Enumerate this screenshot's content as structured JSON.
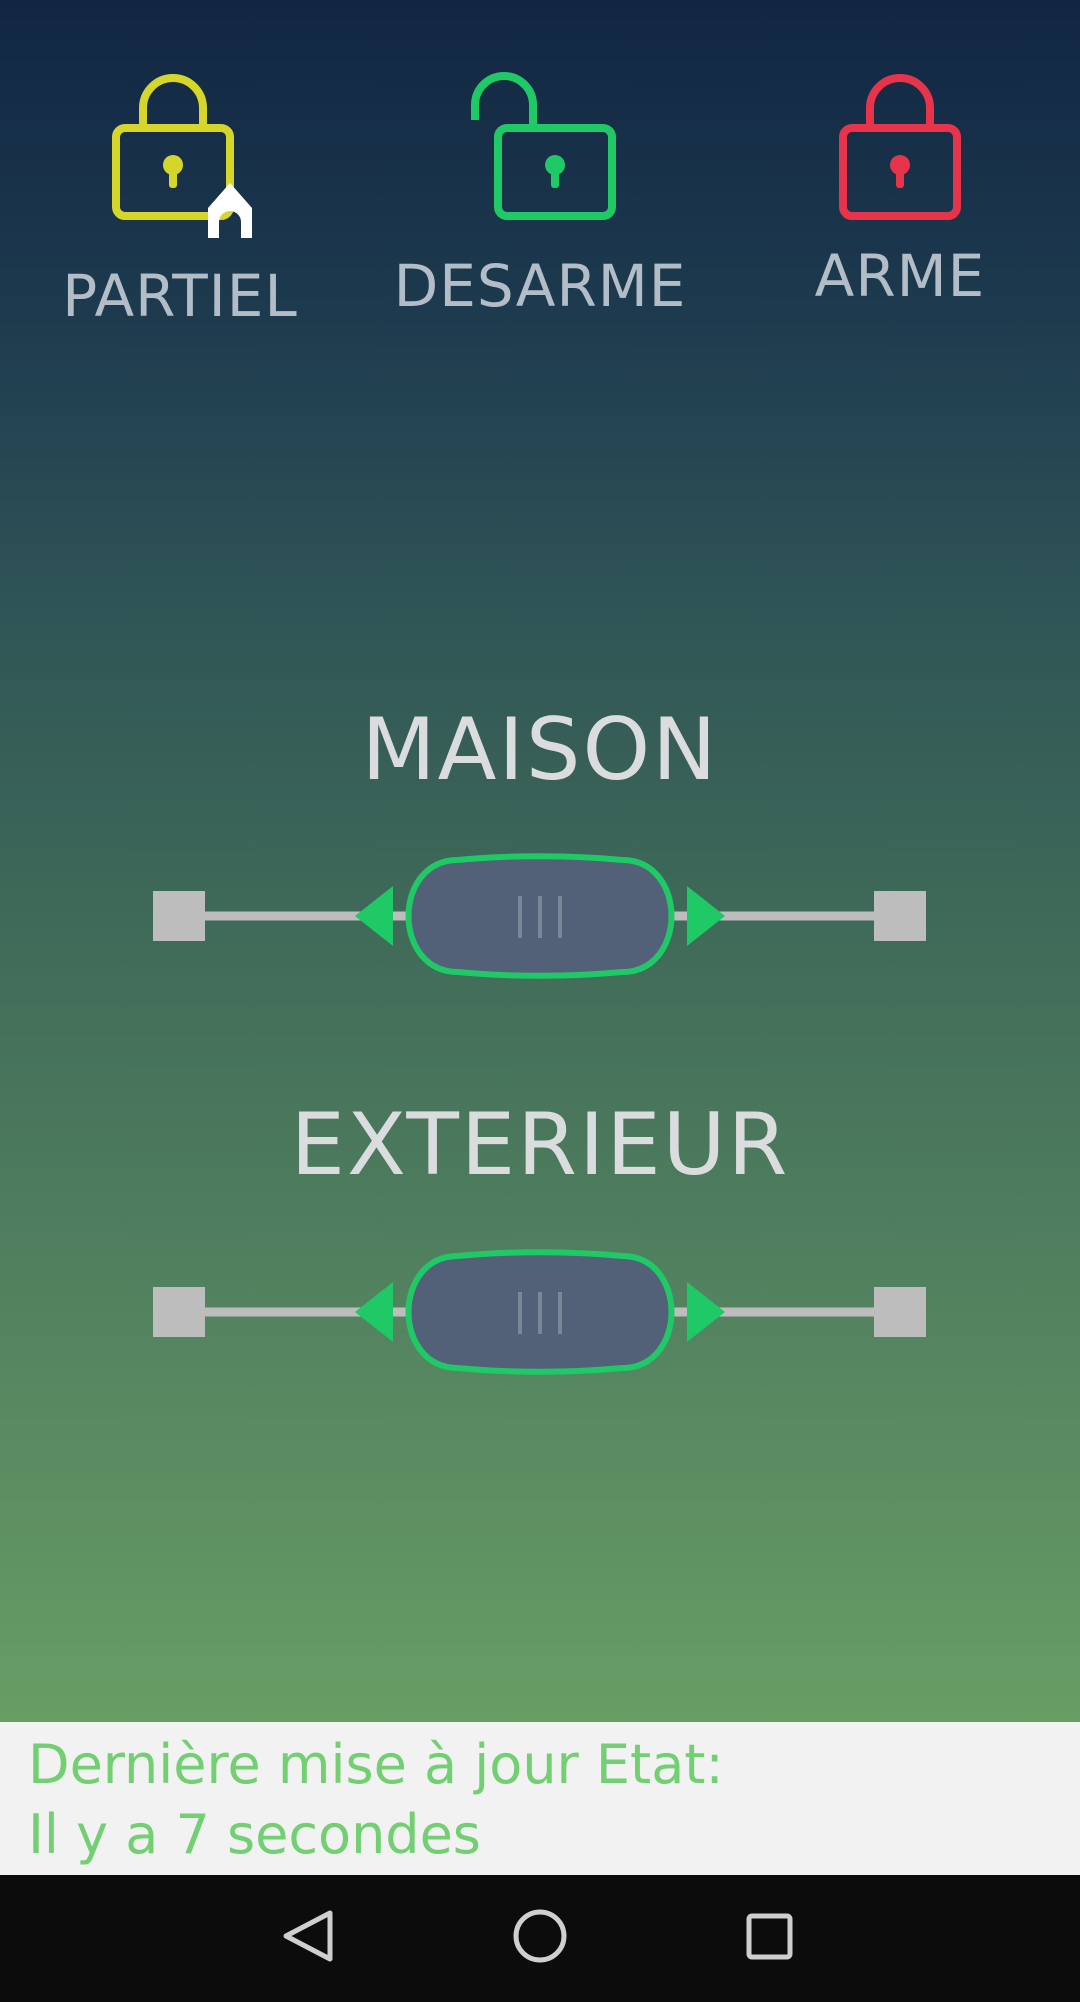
{
  "modes": [
    {
      "label": "PARTIEL",
      "color": "#d6d62a",
      "icon": "padlock-closed-home-icon"
    },
    {
      "label": "DESARME",
      "color": "#1fc965",
      "icon": "padlock-open-icon"
    },
    {
      "label": "ARME",
      "color": "#e8344a",
      "icon": "padlock-closed-icon"
    }
  ],
  "zones": [
    {
      "title": "MAISON",
      "state": "center"
    },
    {
      "title": "EXTERIEUR",
      "state": "center"
    }
  ],
  "colors": {
    "slider_track": "#bdbdbd",
    "slider_handle": "#536178",
    "slider_outline": "#1fc965",
    "status_text": "#72cf72"
  },
  "status": {
    "line1": "Dernière mise à jour Etat:",
    "line2": "Il y a 7 secondes"
  },
  "nav": {
    "back_icon": "back-triangle-icon",
    "home_icon": "home-circle-icon",
    "recents_icon": "recents-square-icon"
  }
}
